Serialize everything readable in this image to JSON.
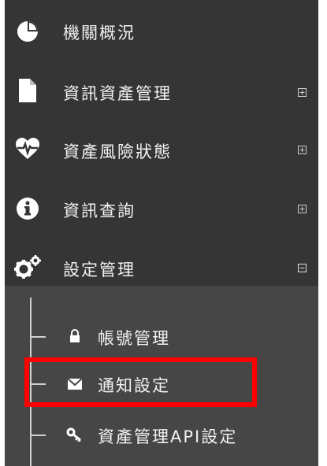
{
  "menu": {
    "items": [
      {
        "label": "機關概況",
        "icon": "pie-chart-icon",
        "expand": ""
      },
      {
        "label": "資訊資產管理",
        "icon": "document-icon",
        "expand": "+"
      },
      {
        "label": "資產風險狀態",
        "icon": "heartbeat-icon",
        "expand": "+"
      },
      {
        "label": "資訊查詢",
        "icon": "info-icon",
        "expand": "+"
      },
      {
        "label": "設定管理",
        "icon": "gears-icon",
        "expand": "-"
      }
    ],
    "subitems": [
      {
        "label": "帳號管理",
        "icon": "lock-icon"
      },
      {
        "label": "通知設定",
        "icon": "envelope-icon"
      },
      {
        "label": "資產管理API設定",
        "icon": "key-icon"
      }
    ]
  },
  "colors": {
    "menu_bg": "#353535",
    "submenu_bg": "#464646",
    "text": "#f2f2f2",
    "highlight": "#ff0000"
  }
}
